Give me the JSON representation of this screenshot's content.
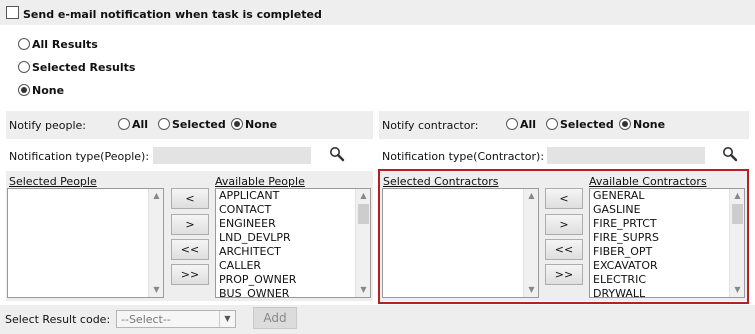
{
  "notify": {
    "label": "Send e-mail notification when task is completed"
  },
  "results": {
    "options": [
      "All Results",
      "Selected Results",
      "None"
    ],
    "selected": "None"
  },
  "people": {
    "label": "Notify people:",
    "options": [
      "All",
      "Selected",
      "None"
    ],
    "selected": "None",
    "type_label": "Notification type(People):",
    "type_value": "",
    "selected_label": "Selected People",
    "available_label": "Available People",
    "available": [
      "APPLICANT",
      "CONTACT",
      "ENGINEER",
      "LND_DEVLPR",
      "ARCHITECT",
      "CALLER",
      "PROP_OWNER",
      "BUS_OWNER"
    ]
  },
  "contractor": {
    "label": "Notify contractor:",
    "options": [
      "All",
      "Selected",
      "None"
    ],
    "selected": "None",
    "type_label": "Notification type(Contractor):",
    "type_value": "",
    "selected_label": "Selected Contractors",
    "available_label": "Available Contractors",
    "available": [
      "GENERAL",
      "GASLINE",
      "FIRE_PRTCT",
      "FIRE_SUPRS",
      "FIBER_OPT",
      "EXCAVATOR",
      "ELECTRIC",
      "DRYWALL"
    ]
  },
  "transfer_buttons": [
    "<",
    ">",
    "<<",
    ">>"
  ],
  "result_code": {
    "label": "Select Result code:",
    "placeholder": "--Select--"
  },
  "add_label": "Add",
  "colors": {
    "highlight_border": "#b22222",
    "band": "#eeeeee",
    "field": "#e3e3e3"
  },
  "icons": {
    "search": "magnifier-icon"
  }
}
